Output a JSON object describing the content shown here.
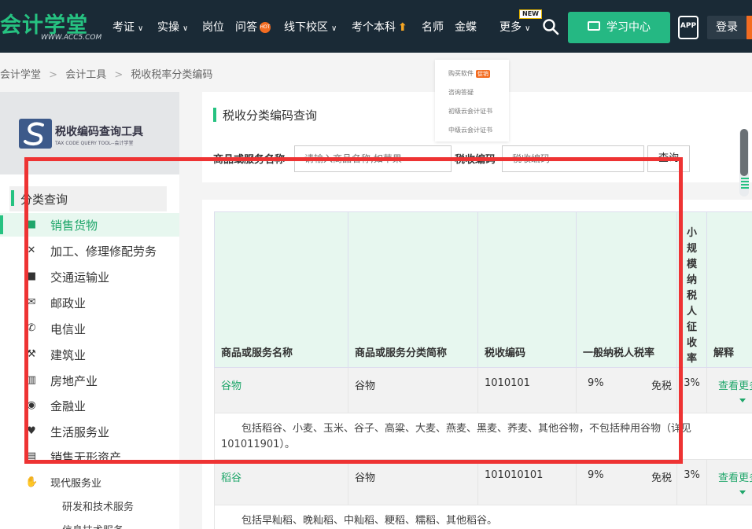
{
  "header": {
    "logo_text": "会计学堂",
    "logo_url": "WWW.ACC5.COM",
    "nav": [
      {
        "label": "考证",
        "dropdown": true
      },
      {
        "label": "实操",
        "dropdown": true
      },
      {
        "label": "岗位",
        "dropdown": false
      },
      {
        "label": "问答",
        "dropdown": false
      },
      {
        "label": "线下校区",
        "dropdown": true
      },
      {
        "label": "考个本科",
        "dropdown": false
      },
      {
        "label": "名师",
        "dropdown": false
      },
      {
        "label": "金蝶",
        "dropdown": false
      },
      {
        "label": "更多",
        "dropdown": true
      }
    ],
    "hot_badge": "HOT",
    "new_badge": "NEW",
    "learning_center": "学习中心",
    "app_label": "APP",
    "login": "登录"
  },
  "breadcrumb": [
    "会计学堂",
    "会计工具",
    "税收税率分类编码"
  ],
  "dropdown_menu": {
    "items": [
      "购买软件",
      "咨询答疑",
      "初级云会计证书",
      "中级云会计证书"
    ],
    "promo_badge": "促销"
  },
  "sidebar": {
    "tool_title": "税收编码查询工具",
    "tool_subtitle": "TAX CODE QUERY TOOL--会计学堂",
    "category_heading": "分类查询",
    "items": [
      {
        "label": "销售货物",
        "icon": "cube-icon",
        "active": true
      },
      {
        "label": "加工、修理修配劳务",
        "icon": "tools-icon",
        "active": false
      },
      {
        "label": "交通运输业",
        "icon": "truck-icon",
        "active": false
      },
      {
        "label": "邮政业",
        "icon": "mail-icon",
        "active": false
      },
      {
        "label": "电信业",
        "icon": "phone-icon",
        "active": false
      },
      {
        "label": "建筑业",
        "icon": "crane-icon",
        "active": false
      },
      {
        "label": "房地产业",
        "icon": "building-icon",
        "active": false
      },
      {
        "label": "金融业",
        "icon": "coin-icon",
        "active": false
      },
      {
        "label": "生活服务业",
        "icon": "heart-hand-icon",
        "active": false
      },
      {
        "label": "销售无形资产",
        "icon": "asset-icon",
        "active": false
      },
      {
        "label": "现代服务业",
        "icon": "handshake-icon",
        "active": false
      }
    ],
    "sub_items": [
      "研发和技术服务",
      "信息技术服务"
    ]
  },
  "search": {
    "title": "税收分类编码查询",
    "name_label": "商品或服务名称",
    "name_placeholder": "请输入商品名称,如苹果",
    "code_label": "税收编码",
    "code_placeholder": "税收编码",
    "query_button": "查询"
  },
  "table": {
    "headers": [
      "商品或服务名称",
      "商品或服务分类简称",
      "税收编码",
      "一般纳税人税率",
      "小规模纳税人征收率",
      "解释"
    ],
    "small_rate_header_chars": [
      "小",
      "规",
      "模",
      "纳",
      "税",
      "人",
      "征",
      "收",
      "率"
    ],
    "rows": [
      {
        "name": "谷物",
        "category": "谷物",
        "code": "1010101",
        "rate": "9%",
        "exempt": "免税",
        "small_rate": "3%",
        "more": "查看更多",
        "description": "包括稻谷、小麦、玉米、谷子、高粱、大麦、燕麦、黑麦、荞麦、其他谷物，不包括种用谷物（详见101011901）。"
      },
      {
        "name": "稻谷",
        "category": "谷物",
        "code": "101010101",
        "rate": "9%",
        "exempt": "免税",
        "small_rate": "3%",
        "more": "查看更多",
        "description": "包括早籼稻、晚籼稻、中籼稻、粳稻、糯稻、其他稻谷。"
      }
    ]
  },
  "colors": {
    "brand_green": "#26c281",
    "topbar": "#1a2a36",
    "highlight_red": "#ee3333"
  }
}
